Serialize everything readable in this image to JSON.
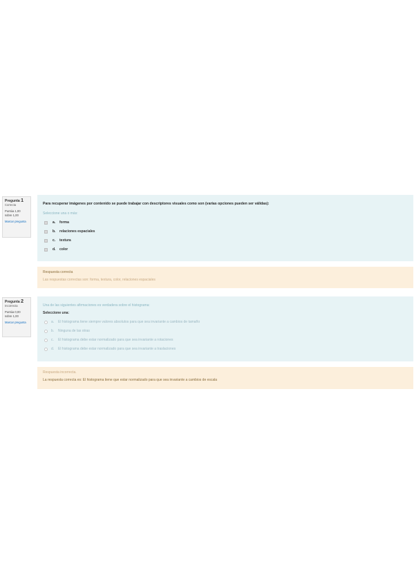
{
  "questions": [
    {
      "info": {
        "label": "Pregunta",
        "number": "1",
        "state": "Correcta",
        "grade": "Puntúa 1,00 sobre 1,00",
        "flag": "Marcar pregunta"
      },
      "text": "Para recuperar imágenes por contenido se puede trabajar con descriptores visuales como son (varias opciones pueden ser válidas):",
      "prompt": "Seleccione una o más:",
      "options": [
        {
          "letter": "a.",
          "text": "forma"
        },
        {
          "letter": "b.",
          "text": "relaciones espaciales"
        },
        {
          "letter": "c.",
          "text": "textura"
        },
        {
          "letter": "d.",
          "text": "color"
        }
      ],
      "feedback": {
        "title": "Respuesta correcta",
        "text": "Las respuestas correctas son: forma, textura, color, relaciones espaciales"
      }
    },
    {
      "info": {
        "label": "Pregunta",
        "number": "2",
        "state": "Incorrecta",
        "grade": "Puntúa 0,00 sobre 1,00",
        "flag": "Marcar pregunta"
      },
      "text": "Una de las siguientes afirmaciones es verdadera sobre el histograma:",
      "prompt": "Seleccione una:",
      "options": [
        {
          "letter": "a.",
          "text": "El histograma tiene siempre valores absolutos para que sea invariante a cambios de tamaño"
        },
        {
          "letter": "b.",
          "text": "Ninguna de las otras"
        },
        {
          "letter": "c.",
          "text": "El histograma debe estar normalizado para que sea invariante a rotaciones"
        },
        {
          "letter": "d.",
          "text": "El histograma debe estar normalizado para que sea invariante a traslaciones"
        }
      ],
      "feedback": {
        "title": "Respuesta incorrecta.",
        "text": "La respuesta correcta es: El histograma tiene que estar normalizado para que sea invariante a cambios de escala"
      }
    }
  ]
}
